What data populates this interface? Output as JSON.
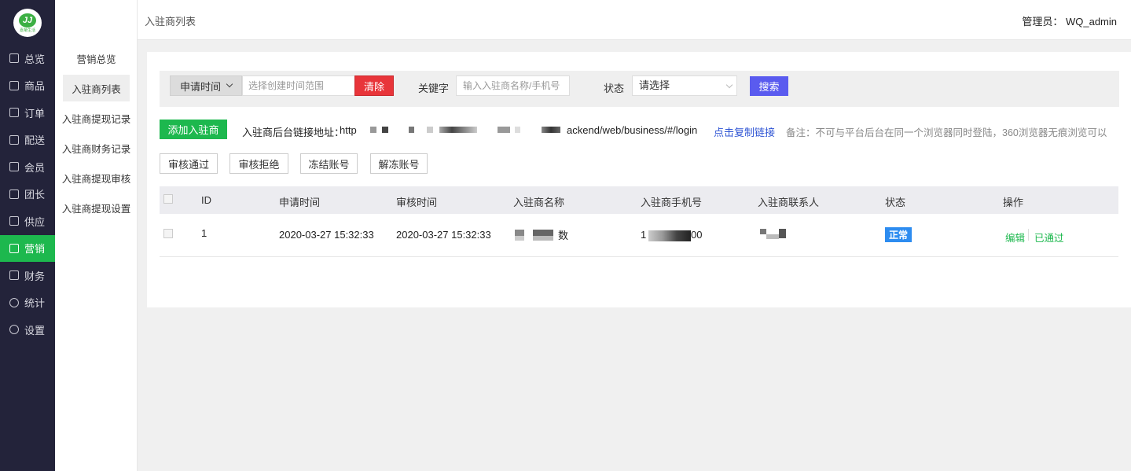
{
  "brand": {
    "logo_text": "嘉菊生活",
    "logo_mark": "JJ"
  },
  "primary_nav": [
    {
      "label": "总览",
      "icon": "home-icon"
    },
    {
      "label": "商品",
      "icon": "box-icon"
    },
    {
      "label": "订单",
      "icon": "order-icon"
    },
    {
      "label": "配送",
      "icon": "delivery-icon"
    },
    {
      "label": "会员",
      "icon": "user-icon"
    },
    {
      "label": "团长",
      "icon": "group-icon"
    },
    {
      "label": "供应",
      "icon": "supply-icon"
    },
    {
      "label": "营销",
      "icon": "gift-icon",
      "active": true
    },
    {
      "label": "财务",
      "icon": "finance-icon"
    },
    {
      "label": "统计",
      "icon": "chart-icon"
    },
    {
      "label": "设置",
      "icon": "gear-icon"
    }
  ],
  "secondary_nav": [
    {
      "label": "营销总览"
    },
    {
      "label": "入驻商列表",
      "active": true
    },
    {
      "label": "入驻商提现记录"
    },
    {
      "label": "入驻商财务记录"
    },
    {
      "label": "入驻商提现审核"
    },
    {
      "label": "入驻商提现设置"
    }
  ],
  "header": {
    "breadcrumb": "入驻商列表",
    "admin": "管理员： WQ_admin"
  },
  "filter": {
    "date_type": "申请时间",
    "date_placeholder": "选择创建时间范围",
    "clear_label": "清除",
    "keyword_label": "关键字",
    "keyword_placeholder": "输入入驻商名称/手机号",
    "status_label": "状态",
    "status_value": "请选择",
    "search_label": "搜索"
  },
  "actions": {
    "add_label": "添加入驻商",
    "link_label": "入驻商后台链接地址：",
    "link_prefix": "http",
    "link_suffix": "ackend/web/business/#/login",
    "copy_label": "点击复制链接",
    "remark": "备注：不可与平台后台在同一个浏览器同时登陆，360浏览器无痕浏览可以"
  },
  "bulk_buttons": [
    "审核通过",
    "审核拒绝",
    "冻结账号",
    "解冻账号"
  ],
  "table": {
    "headers": [
      "ID",
      "申请时间",
      "审核时间",
      "入驻商名称",
      "入驻商手机号",
      "入驻商联系人",
      "状态",
      "操作"
    ],
    "rows": [
      {
        "id": "1",
        "apply_time": "2020-03-27 15:32:33",
        "review_time": "2020-03-27 15:32:33",
        "name_visible": "数",
        "phone_prefix": "1",
        "phone_suffix": "00",
        "status": "正常",
        "status_color": "#2d8cf0",
        "edit_label": "编辑",
        "passed_label": "已通过"
      }
    ]
  },
  "colors": {
    "sidebar": "#23233a",
    "accent_green": "#1db84e",
    "danger": "#e8353a",
    "primary": "#5a5bef",
    "link": "#2f55d4"
  }
}
